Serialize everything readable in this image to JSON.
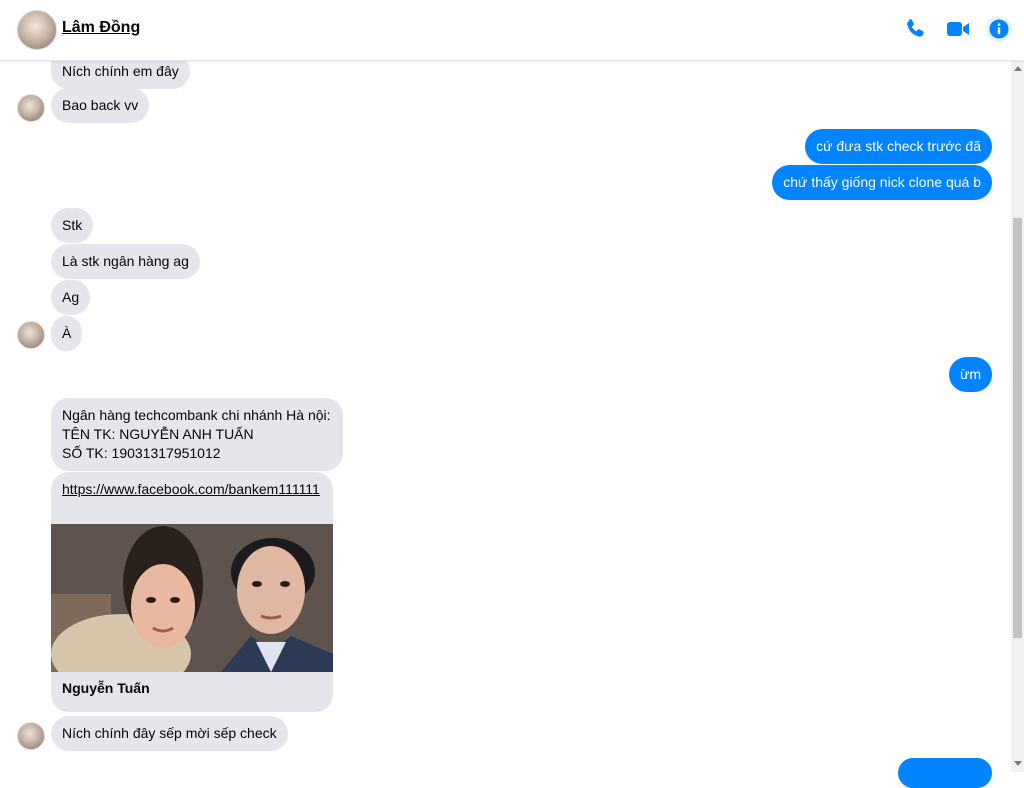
{
  "header": {
    "contact_name": "Lâm Đồng"
  },
  "icons": {
    "phone": "phone-icon",
    "video": "video-camera-icon",
    "info": "info-icon"
  },
  "colors": {
    "accent": "#0084ff",
    "incoming_bubble": "#e4e6eb"
  },
  "messages": {
    "m1": "Ních chính em đây",
    "m2": "Bao back vv",
    "m3": "cứ đưa stk check trước đã",
    "m4": "chứ thấy giống nick clone quá b",
    "m5": "Stk",
    "m6": "Là stk ngân hàng ag",
    "m7": "Ag",
    "m8": "À",
    "m9": "ừm",
    "m10": {
      "line1": "Ngân hàng techcombank chi nhánh Hà nội:",
      "line2": "TÊN TK: NGUYỄN ANH TUẤN",
      "line3": "SỐ TK: 19031317951012"
    },
    "link_card": {
      "url": "https://www.facebook.com/bankem111111",
      "title": "Nguyễn Tuấn"
    },
    "m11": "Ních chính đây sếp mời sếp check"
  }
}
